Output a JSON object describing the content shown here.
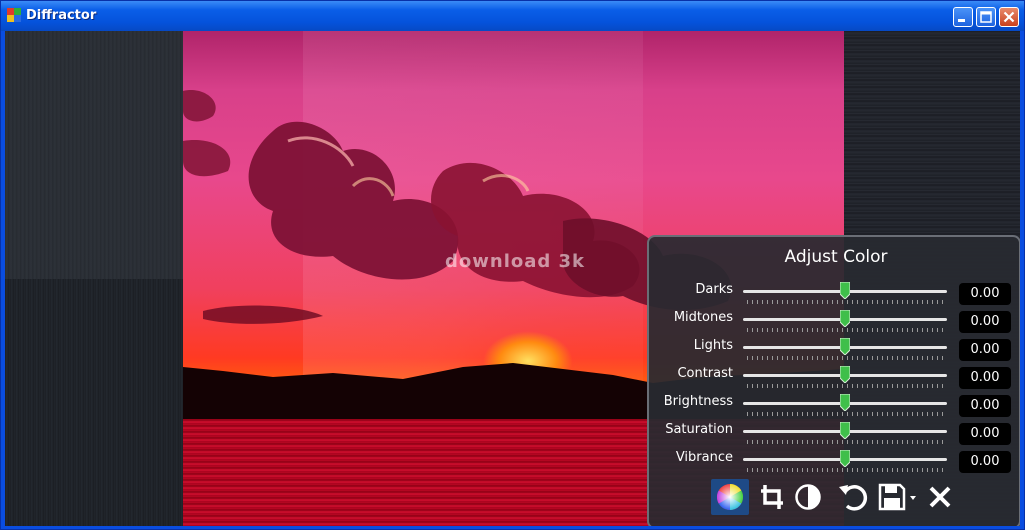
{
  "window": {
    "title": "Diffractor",
    "controls": [
      "minimize-icon",
      "maximize-icon",
      "close-icon"
    ]
  },
  "photo": {
    "watermark": "download 3k"
  },
  "panel": {
    "title": "Adjust Color",
    "sliders": [
      {
        "label": "Darks",
        "value": "0.00"
      },
      {
        "label": "Midtones",
        "value": "0.00"
      },
      {
        "label": "Lights",
        "value": "0.00"
      },
      {
        "label": "Contrast",
        "value": "0.00"
      },
      {
        "label": "Brightness",
        "value": "0.00"
      },
      {
        "label": "Saturation",
        "value": "0.00"
      },
      {
        "label": "Vibrance",
        "value": "0.00"
      }
    ],
    "toolbar": [
      "color-wheel-icon",
      "crop-icon",
      "contrast-icon",
      "undo-icon",
      "save-icon",
      "chevron-down-icon",
      "close-icon"
    ]
  },
  "colors": {
    "titlebar": "#0a5ee8",
    "panel_bg": "#282a30",
    "selected_tool": "#1e4a86",
    "thumb": "#3fbf4a"
  }
}
